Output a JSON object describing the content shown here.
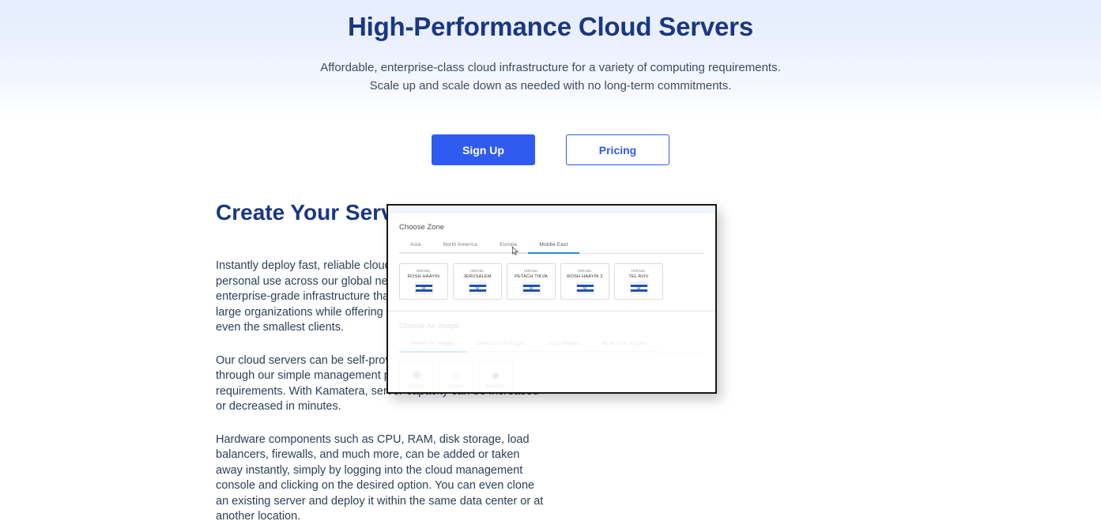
{
  "theme": {
    "navy": "#1a3780",
    "accent_blue": "#2f5bf0",
    "body_text": "#2c4058",
    "hero_gradient_top": "#e6edfd",
    "hero_gradient_bottom": "#ffffff",
    "tab_active_underline": "#2e8bc9",
    "flag_blue": "#1f50b5"
  },
  "hero": {
    "title": "High-Performance Cloud Servers",
    "subtitle_line1": "Affordable, enterprise-class cloud infrastructure for a variety of computing requirements.",
    "subtitle_line2": "Scale up and scale down as needed with no long-term commitments.",
    "buttons": [
      {
        "label": "Sign Up",
        "style": "primary"
      },
      {
        "label": "Pricing",
        "style": "secondary"
      }
    ]
  },
  "section": {
    "title": "Create Your Servers in Minutes",
    "paragraphs": [
      "Instantly deploy fast, reliable cloud servers for business or personal use across our global network of data centers. Enjoy enterprise-grade infrastructure that's powerful enough to support large organizations while offering versatility that's suitable for even the smallest clients.",
      "Our cloud servers can be self-provisioned and self-configured through our simple management portal to suit your changing requirements. With Kamatera, server capacity can be increased or decreased in minutes.",
      "Hardware components such as CPU, RAM, disk storage, load balancers, firewalls, and much more, can be added or taken away instantly, simply by logging into the cloud management console and clicking on the desired option. You can even clone an existing server and deploy it within the same data center or at another location."
    ]
  },
  "app_screenshot": {
    "zone_panel": {
      "title": "Choose Zone",
      "tabs": [
        {
          "label": "Asia",
          "active": false
        },
        {
          "label": "North America",
          "active": false
        },
        {
          "label": "Europe",
          "active": false
        },
        {
          "label": "Middle East",
          "active": true
        }
      ],
      "zones": [
        {
          "country": "ISRAEL",
          "city": "ROSH HAAYIN",
          "flag": "israel-flag"
        },
        {
          "country": "ISRAEL",
          "city": "JERUSALEM",
          "flag": "israel-flag"
        },
        {
          "country": "ISRAEL",
          "city": "PETACH TIKVA",
          "flag": "israel-flag"
        },
        {
          "country": "ISRAEL",
          "city": "ROSH HAAYIN 2",
          "flag": "israel-flag"
        },
        {
          "country": "ISRAEL",
          "city": "TEL AVIV",
          "flag": "israel-flag"
        }
      ]
    },
    "image_panel": {
      "title": "Choose An Image",
      "tabs": [
        {
          "label": "Server OS Images",
          "active": true
        },
        {
          "label": "Desktop OS Images",
          "active": false
        },
        {
          "label": "Apps Images",
          "active": false
        },
        {
          "label": "My Private Images",
          "active": false
        }
      ],
      "images": [
        {
          "label": "CentOS",
          "logo": "centos-logo",
          "glyph": "✸"
        },
        {
          "label": "Debian",
          "logo": "debian-logo",
          "glyph": "@"
        },
        {
          "label": "FreeBSD",
          "logo": "freebsd-logo",
          "glyph": "◕"
        }
      ]
    }
  }
}
